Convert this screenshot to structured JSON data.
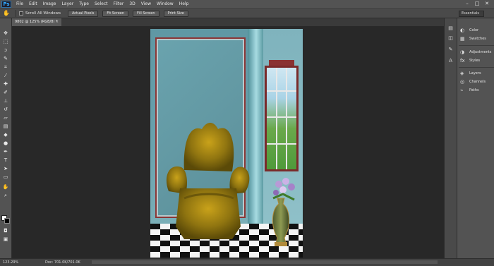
{
  "app": {
    "logo": "Ps",
    "menu": [
      "File",
      "Edit",
      "Image",
      "Layer",
      "Type",
      "Select",
      "Filter",
      "3D",
      "View",
      "Window",
      "Help"
    ],
    "window_controls": [
      "–",
      "□",
      "✕"
    ]
  },
  "options_bar": {
    "tool_icon": "hand-tool-icon",
    "scroll_all_label": "Scroll All Windows",
    "buttons": [
      "Actual Pixels",
      "Fit Screen",
      "Fill Screen",
      "Print Size"
    ],
    "workspace": "Essentials"
  },
  "document": {
    "tab_title": "9802 @ 125% (RGB/8) *",
    "close_glyph": "×"
  },
  "panels": {
    "group1": [
      {
        "label": "Color",
        "icon": "color-wheel-icon"
      },
      {
        "label": "Swatches",
        "icon": "swatches-grid-icon"
      }
    ],
    "group2": [
      {
        "label": "Adjustments",
        "icon": "adjustments-icon"
      },
      {
        "label": "Styles",
        "icon": "styles-icon"
      }
    ],
    "group3": [
      {
        "label": "Layers",
        "icon": "layers-icon"
      },
      {
        "label": "Channels",
        "icon": "channels-icon"
      },
      {
        "label": "Paths",
        "icon": "paths-icon"
      }
    ]
  },
  "status": {
    "zoom": "123.29%",
    "doc_size": "Doc: 701.0K/701.0K"
  },
  "colors": {
    "accent": "#31a8ff",
    "foreground": "#ffffff",
    "background": "#000000"
  }
}
